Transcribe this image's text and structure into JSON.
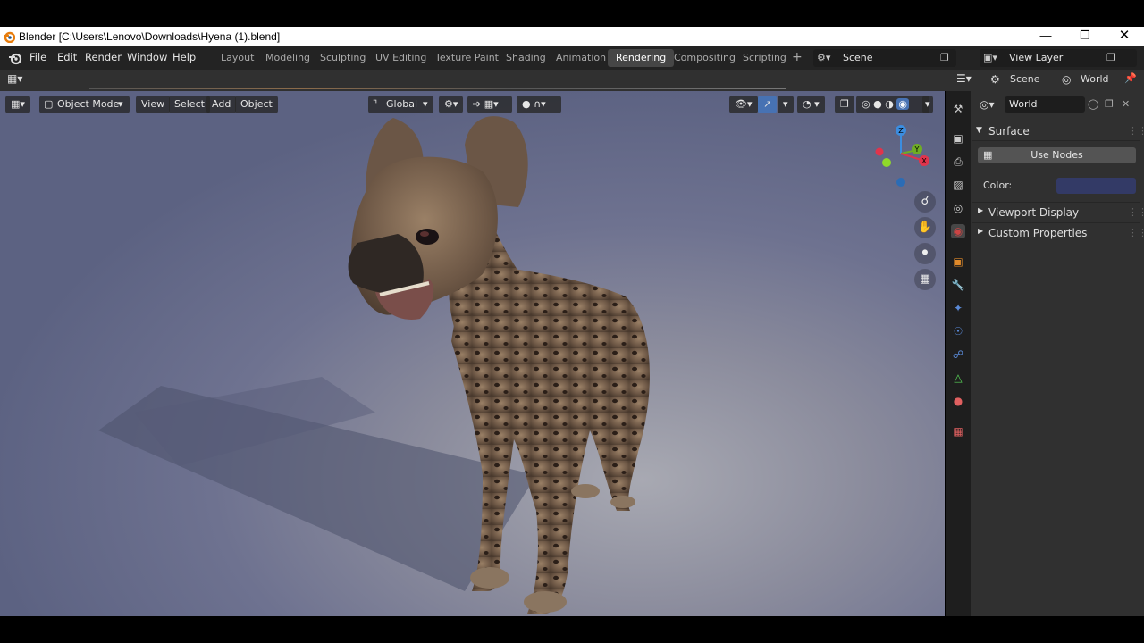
{
  "window": {
    "title": "Blender [C:\\Users\\Lenovo\\Downloads\\Hyena (1).blend]"
  },
  "menus": [
    "File",
    "Edit",
    "Render",
    "Window",
    "Help"
  ],
  "workspaces": [
    "Layout",
    "Modeling",
    "Sculpting",
    "UV Editing",
    "Texture Paint",
    "Shading",
    "Animation",
    "Rendering",
    "Compositing",
    "Scripting"
  ],
  "active_workspace": "Rendering",
  "scene_name": "Scene",
  "view_layer": "View Layer",
  "viewport": {
    "mode": "Object Mode",
    "menus": [
      "View",
      "Select",
      "Add",
      "Object"
    ],
    "orientation": "Global",
    "gizmo_axes": [
      "Z",
      "Y",
      "X"
    ]
  },
  "properties": {
    "context_scene": "Scene",
    "context_world": "World",
    "world_name": "World",
    "panel_surface": "Surface",
    "use_nodes_label": "Use Nodes",
    "color_label": "Color:",
    "color_value": "#333a66",
    "panel_viewport_display": "Viewport Display",
    "panel_custom_properties": "Custom Properties"
  },
  "colors": {
    "accent": "#4772b3",
    "header": "#303030",
    "topbar": "#232323"
  },
  "icons": [
    "blender-logo-icon",
    "minimize-icon",
    "restore-icon",
    "close-icon",
    "add-workspace-icon",
    "editor-type-icon",
    "zoom-icon",
    "pan-hand-icon",
    "camera-icon",
    "grid-icon",
    "pin-icon",
    "render-tab-icon",
    "output-tab-icon",
    "view-layer-tab-icon",
    "scene-tab-icon",
    "world-tab-icon",
    "object-tab-icon",
    "modifier-tab-icon",
    "particles-tab-icon",
    "physics-tab-icon",
    "constraints-tab-icon",
    "data-tab-icon",
    "material-tab-icon",
    "texture-tab-icon"
  ]
}
